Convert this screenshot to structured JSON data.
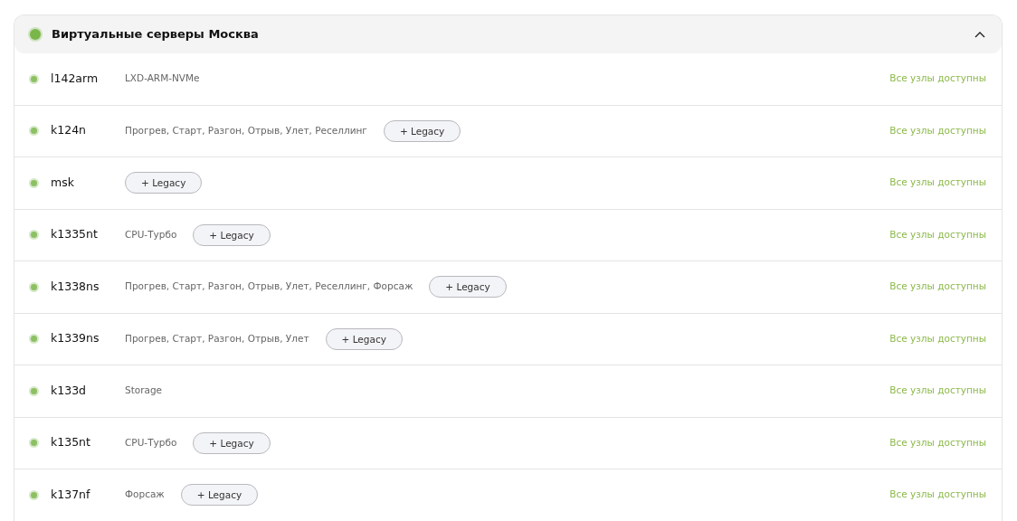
{
  "group": {
    "title": "Виртуальные серверы Москва",
    "expanded": true,
    "color": "#7ab648"
  },
  "servers": [
    {
      "name": "l142arm",
      "tariffs": "LXD-ARM-NVMe",
      "status": "Все узлы доступны",
      "color": "#8cc063"
    },
    {
      "name": "k124n",
      "tariffs": "Прогрев, Старт, Разгон, Отрыв, Улет, Реселлинг",
      "legacy_button": "+ Legacy",
      "status": "Все узлы доступны",
      "color": "#8cc063"
    },
    {
      "name": "msk",
      "legacy_button": "+ Legacy",
      "status": "Все узлы доступны",
      "color": "#8cc063"
    },
    {
      "name": "k1335nt",
      "tariffs": "CPU-Турбо",
      "legacy_button": "+ Legacy",
      "status": "Все узлы доступны",
      "color": "#8cc063"
    },
    {
      "name": "k1338ns",
      "tariffs": "Прогрев, Старт, Разгон, Отрыв, Улет, Реселлинг, Форсаж",
      "legacy_button": "+ Legacy",
      "status": "Все узлы доступны",
      "color": "#8cc063"
    },
    {
      "name": "k1339ns",
      "tariffs": "Прогрев, Старт, Разгон, Отрыв, Улет",
      "legacy_button": "+ Legacy",
      "status": "Все узлы доступны",
      "color": "#8cc063"
    },
    {
      "name": "k133d",
      "tariffs": "Storage",
      "status": "Все узлы доступны",
      "color": "#8cc063"
    },
    {
      "name": "k135nt",
      "tariffs": "CPU-Турбо",
      "legacy_button": "+ Legacy",
      "status": "Все узлы доступны",
      "color": "#8cc063"
    },
    {
      "name": "k137nf",
      "tariffs": "Форсаж",
      "legacy_button": "+ Legacy",
      "status": "Все узлы доступны",
      "color": "#8cc063"
    }
  ]
}
